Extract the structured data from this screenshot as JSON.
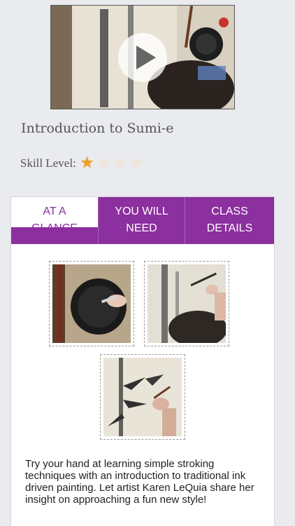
{
  "class": {
    "title": "Introduction to Sumi-e",
    "skill_label": "Skill Level:",
    "skill_rating": 1,
    "skill_max": 4
  },
  "icons": {
    "play": "play-icon",
    "star": "star-icon"
  },
  "tabs": [
    {
      "label": "AT A GLANCE",
      "active": true
    },
    {
      "label": "YOU WILL NEED",
      "active": false
    },
    {
      "label": "CLASS DETAILS",
      "active": false
    }
  ],
  "description": "Try your hand at learning simple stroking techniques with an introduction to traditional ink driven painting. Let artist Karen LeQuia share her insight on approaching a fun new style!",
  "colors": {
    "accent": "#8c2f9f",
    "background": "#e9ebee",
    "star": "#f3a11c"
  }
}
